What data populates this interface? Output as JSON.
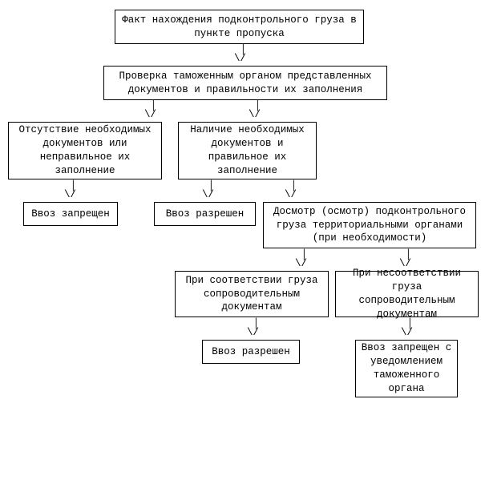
{
  "nodes": {
    "n1": "Факт нахождения подконтрольного груза\nв пункте пропуска",
    "n2": "Проверка таможенным органом представленных\nдокументов и правильности их заполнения",
    "n3": "Отсутствие необходимых\nдокументов или\nнеправильное их\nзаполнение",
    "n4": "Наличие необходимых\nдокументов и\nправильное их\nзаполнение",
    "n5": "Ввоз запрещен",
    "n6": "Ввоз разрешен",
    "n7": "Досмотр (осмотр) подконтрольного\nгруза территориальными органами\n(при необходимости)",
    "n8": "При соответствии груза\nсопроводительным\nдокументам",
    "n9": "При несоответствии груза\nсопроводительным\nдокументам",
    "n10": "Ввоз разрешен",
    "n11": "Ввоз запрещен\nс уведомлением\nтаможенного\nоргана"
  },
  "arrow_glyph": " │\n\\/",
  "chart_data": {
    "type": "flowchart",
    "title": "",
    "nodes": [
      {
        "id": "n1",
        "label": "Факт нахождения подконтрольного груза в пункте пропуска"
      },
      {
        "id": "n2",
        "label": "Проверка таможенным органом представленных документов и правильности их заполнения"
      },
      {
        "id": "n3",
        "label": "Отсутствие необходимых документов или неправильное их заполнение"
      },
      {
        "id": "n4",
        "label": "Наличие необходимых документов и правильное их заполнение"
      },
      {
        "id": "n5",
        "label": "Ввоз запрещен"
      },
      {
        "id": "n6",
        "label": "Ввоз разрешен"
      },
      {
        "id": "n7",
        "label": "Досмотр (осмотр) подконтрольного груза территориальными органами (при необходимости)"
      },
      {
        "id": "n8",
        "label": "При соответствии груза сопроводительным документам"
      },
      {
        "id": "n9",
        "label": "При несоответствии груза сопроводительным документам"
      },
      {
        "id": "n10",
        "label": "Ввоз разрешен"
      },
      {
        "id": "n11",
        "label": "Ввоз запрещен с уведомлением таможенного органа"
      }
    ],
    "edges": [
      {
        "from": "n1",
        "to": "n2"
      },
      {
        "from": "n2",
        "to": "n3"
      },
      {
        "from": "n2",
        "to": "n4"
      },
      {
        "from": "n3",
        "to": "n5"
      },
      {
        "from": "n4",
        "to": "n6"
      },
      {
        "from": "n4",
        "to": "n7"
      },
      {
        "from": "n7",
        "to": "n8"
      },
      {
        "from": "n7",
        "to": "n9"
      },
      {
        "from": "n8",
        "to": "n10"
      },
      {
        "from": "n9",
        "to": "n11"
      }
    ]
  }
}
